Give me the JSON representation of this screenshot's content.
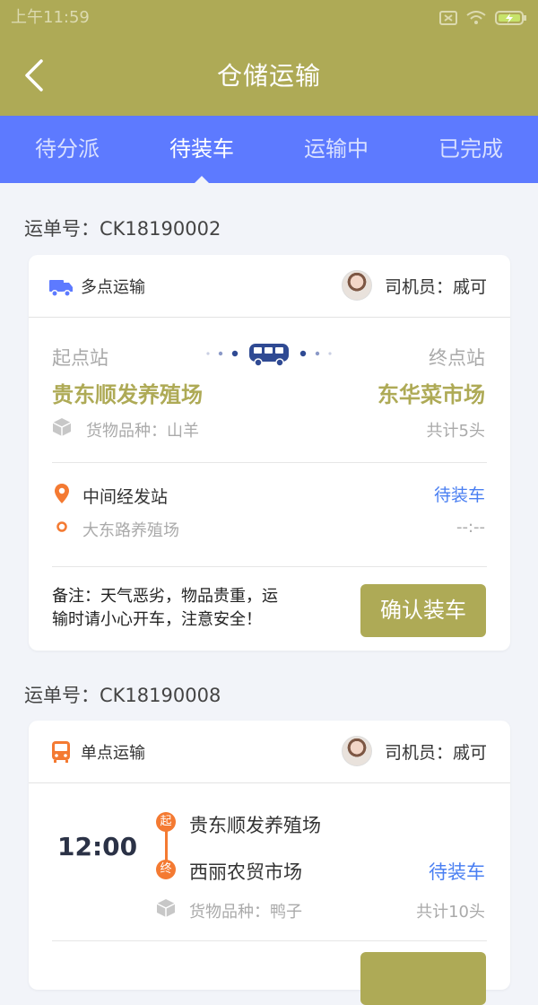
{
  "status_bar": {
    "time": "上午11:59"
  },
  "navbar": {
    "title": "仓储运输"
  },
  "tabs": [
    {
      "label": "待分派",
      "active": false
    },
    {
      "label": "待装车",
      "active": true
    },
    {
      "label": "运输中",
      "active": false
    },
    {
      "label": "已完成",
      "active": false
    }
  ],
  "orders": [
    {
      "order_no": "运单号：CK18190002",
      "type_label": "多点运输",
      "driver": "司机员：戚可",
      "start_label": "起点站",
      "end_label": "终点站",
      "start_name": "贵东顺发养殖场",
      "end_name": "东华菜市场",
      "goods": "货物品种：山羊",
      "quantity": "共计5头",
      "midpoint_title": "中间经发站",
      "midpoint_status": "待装车",
      "midpoint_name": "大东路养殖场",
      "midpoint_time": "--:--",
      "note_line1": "备注：天气恶劣，物品贵重，运",
      "note_line2": "输时请小心开车，注意安全！",
      "button": "确认装车"
    },
    {
      "order_no": "运单号：CK18190008",
      "type_label": "单点运输",
      "driver": "司机员：戚可",
      "time": "12:00",
      "start_badge": "起",
      "end_badge": "终",
      "start_name": "贵东顺发养殖场",
      "end_name": "西丽农贸市场",
      "status": "待装车",
      "goods": "货物品种：鸭子",
      "quantity": "共计10头"
    }
  ],
  "colors": {
    "olive": "#aeaa56",
    "blue_tab": "#5d7aff",
    "status_blue": "#4a7ff2",
    "orange": "#f47a32"
  }
}
